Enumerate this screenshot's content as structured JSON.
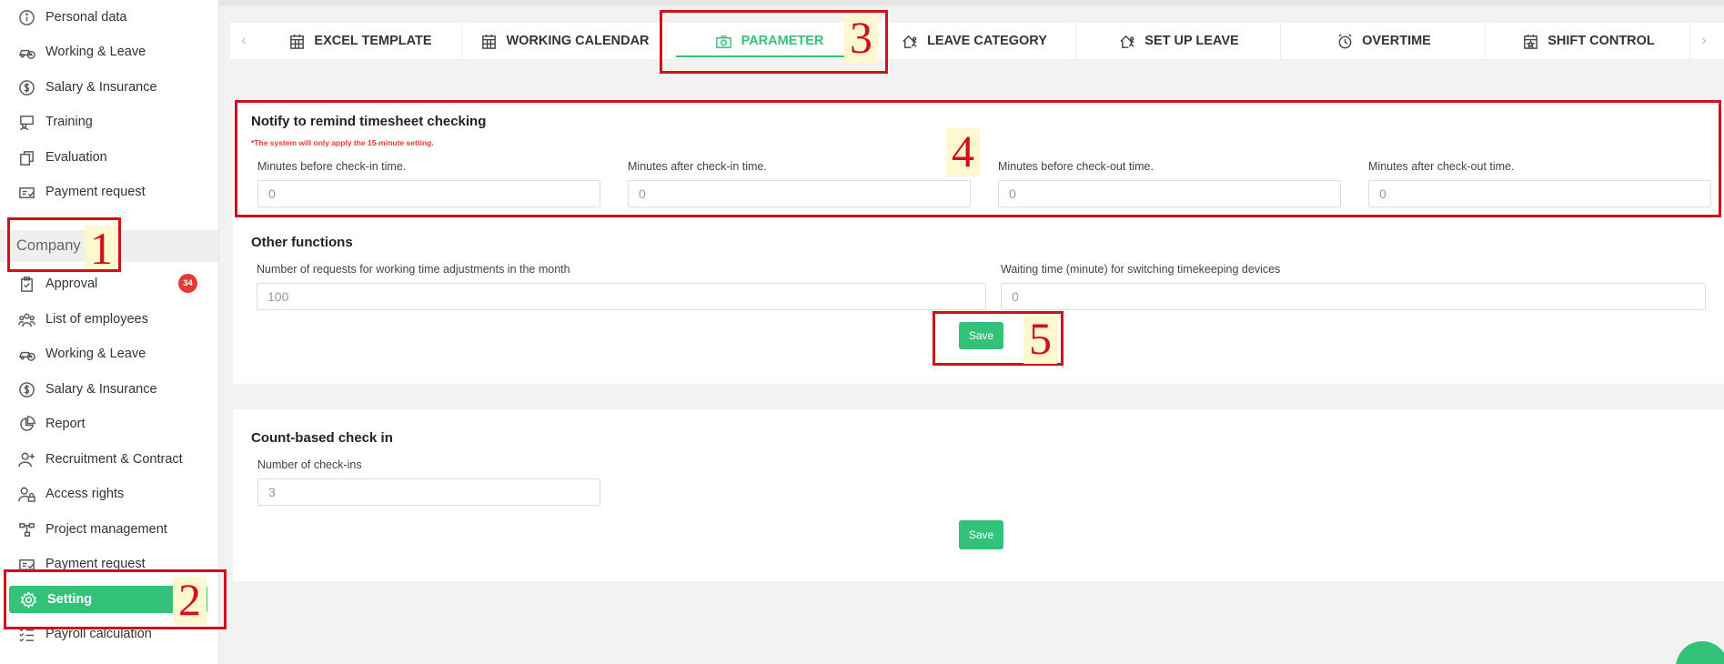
{
  "sidebar": {
    "personal_items": [
      {
        "label": "Personal data",
        "icon": "info-icon"
      },
      {
        "label": "Working & Leave",
        "icon": "car-clock-icon"
      },
      {
        "label": "Salary & Insurance",
        "icon": "dollar-circle-icon"
      },
      {
        "label": "Training",
        "icon": "teacher-icon"
      },
      {
        "label": "Evaluation",
        "icon": "evaluation-icon"
      },
      {
        "label": "Payment request",
        "icon": "payment-card-icon"
      }
    ],
    "section_title": "Company",
    "company_items": [
      {
        "label": "Approval",
        "icon": "clipboard-check-icon",
        "badge": "34"
      },
      {
        "label": "List of employees",
        "icon": "people-icon"
      },
      {
        "label": "Working & Leave",
        "icon": "car-clock-icon"
      },
      {
        "label": "Salary & Insurance",
        "icon": "dollar-circle-icon"
      },
      {
        "label": "Report",
        "icon": "pie-chart-icon"
      },
      {
        "label": "Recruitment & Contract",
        "icon": "user-plus-icon"
      },
      {
        "label": "Access rights",
        "icon": "user-lock-icon"
      },
      {
        "label": "Project management",
        "icon": "project-tree-icon"
      },
      {
        "label": "Payment request",
        "icon": "payment-card-icon"
      },
      {
        "label": "Setting",
        "icon": "gear-icon"
      },
      {
        "label": "Payroll calculation",
        "icon": "checklist-icon"
      }
    ]
  },
  "tabs": [
    {
      "label": "EXCEL TEMPLATE",
      "icon": "calendar-grid-icon"
    },
    {
      "label": "WORKING CALENDAR",
      "icon": "calendar-grid-icon"
    },
    {
      "label": "PARAMETER",
      "icon": "camera-icon",
      "active": true
    },
    {
      "label": "LEAVE CATEGORY",
      "icon": "house-run-icon"
    },
    {
      "label": "SET UP LEAVE",
      "icon": "house-run-icon"
    },
    {
      "label": "OVERTIME",
      "icon": "alarm-clock-icon"
    },
    {
      "label": "SHIFT CONTROL",
      "icon": "calendar-star-icon"
    }
  ],
  "tab_nav": {
    "prev": "‹",
    "next": "›"
  },
  "notify": {
    "title": "Notify to remind timesheet checking",
    "warning": "*The system will only apply the 15-minute setting.",
    "fields": [
      {
        "label": "Minutes before check-in time.",
        "value": "0"
      },
      {
        "label": "Minutes after check-in time.",
        "value": "0"
      },
      {
        "label": "Minutes before check-out time.",
        "value": "0"
      },
      {
        "label": "Minutes after check-out time.",
        "value": "0"
      }
    ]
  },
  "other": {
    "title": "Other functions",
    "fields": [
      {
        "label": "Number of requests for working time adjustments in the month",
        "value": "100"
      },
      {
        "label": "Waiting time (minute) for switching timekeeping devices",
        "value": "0"
      }
    ],
    "save_label": "Save"
  },
  "count": {
    "title": "Count-based check in",
    "field": {
      "label": "Number of check-ins",
      "value": "3"
    },
    "save_label": "Save"
  },
  "annotations": [
    "1",
    "2",
    "3",
    "4",
    "5"
  ],
  "colors": {
    "accent": "#34c17a",
    "annotation": "#d0111b",
    "badge": "#e53935"
  }
}
